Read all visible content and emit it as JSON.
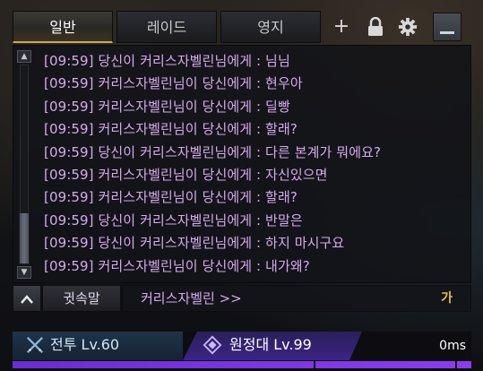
{
  "tabs": [
    {
      "label": "일반",
      "active": true
    },
    {
      "label": "레이드",
      "active": false
    },
    {
      "label": "영지",
      "active": false
    }
  ],
  "toolbar_icons": [
    "plus-icon",
    "lock-icon",
    "gear-icon",
    "minimize-icon"
  ],
  "chat": {
    "lines": [
      "[09:59] 당신이 커리스자벨린님에게 : 님님",
      "[09:59] 커리스자벨린님이 당신에게 : 현우아",
      "[09:59] 커리스자벨린님이 당신에게 : 딜빵",
      "[09:59] 커리스자벨린님이 당신에게 : 할래?",
      "[09:59] 당신이 커리스자벨린님에게 : 다른 본계가 뭐에요?",
      "[09:59] 커리스자벨린님이 당신에게 : 자신있으면",
      "[09:59] 커리스자벨린님이 당신에게 : 할래?",
      "[09:59] 당신이 커리스자벨린님에게 : 반말은",
      "[09:59] 당신이 커리스자벨린님에게 : 하지 마시구요",
      "[09:59] 커리스자벨린님이 당신에게 : 내가왜?"
    ],
    "whisper_color": "#d7a9ef"
  },
  "input": {
    "channel_label": "귓속말",
    "target_text": "커리스자벨린 >>",
    "ime_indicator": "가"
  },
  "bottom": {
    "stance_combat": "전투 Lv.60",
    "stance_expedition": "원정대 Lv.99",
    "ping": "0ms"
  },
  "colors": {
    "accent_gold": "#c9a85a",
    "expedition_purple": "#3b2585",
    "xp_fill": "#8b3cf0"
  }
}
